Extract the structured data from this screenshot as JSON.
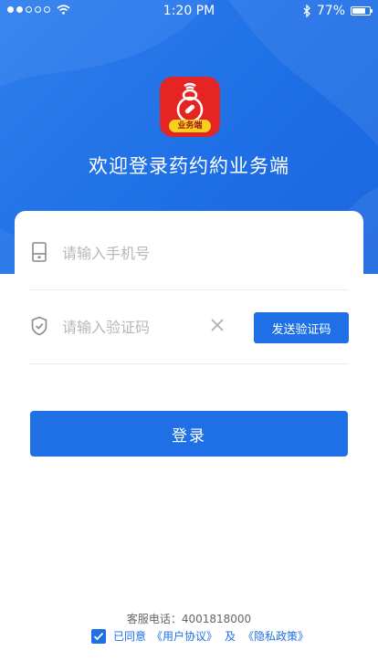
{
  "status_bar": {
    "time": "1:20 PM",
    "battery": "77%",
    "battery_level": 0.77,
    "signal_dots": [
      true,
      true,
      false,
      false,
      false
    ]
  },
  "header": {
    "logo_badge": "业务端",
    "welcome": "欢迎登录药约約业务端"
  },
  "form": {
    "phone_placeholder": "请输入手机号",
    "code_placeholder": "请输入验证码",
    "send_code_label": "发送验证码",
    "login_label": "登录"
  },
  "footer": {
    "service_phone": "客服电话：4001818000",
    "agree_text": "已同意",
    "user_agreement": "《用户协议》",
    "and": "及",
    "privacy_policy": "《隐私政策》",
    "agreed": true
  },
  "colors": {
    "primary": "#1f6fe6",
    "logo_red": "#e52424",
    "logo_yellow": "#f7d21b"
  },
  "icons": [
    "wifi-icon",
    "bluetooth-icon",
    "battery-icon",
    "phone-icon",
    "shield-icon",
    "clear-icon",
    "check-icon"
  ]
}
